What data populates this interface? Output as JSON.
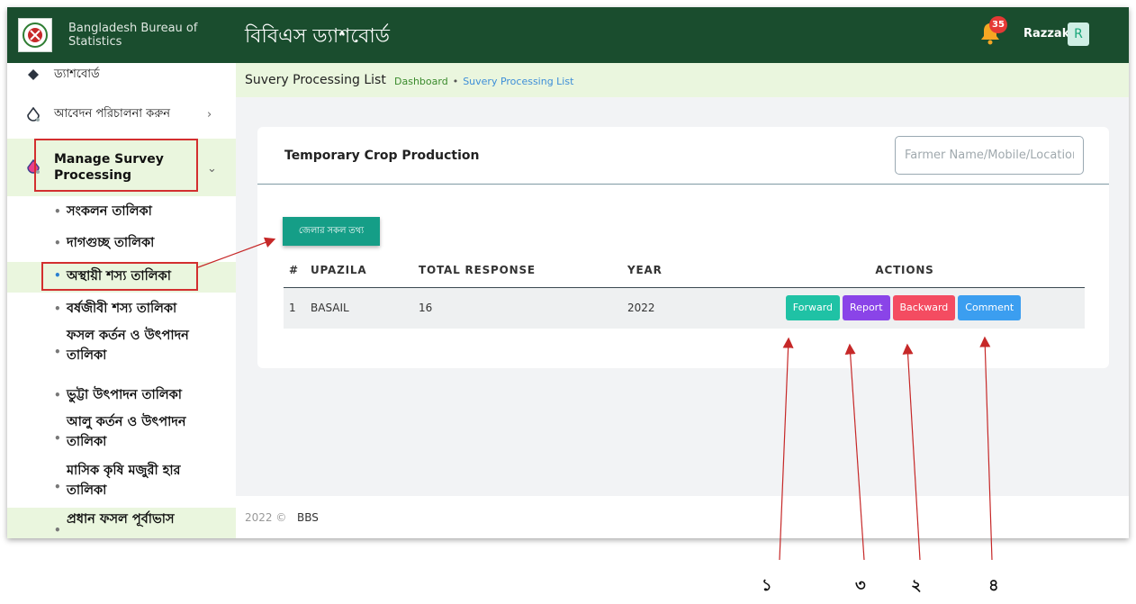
{
  "header": {
    "org_name": "Bangladesh Bureau of Statistics",
    "title": "বিবিএস ড্যাশবোর্ড",
    "notification_count": "35",
    "username": "Razzak",
    "avatar_initial": "R",
    "accent": "#1a4d2e"
  },
  "sidebar": {
    "items": [
      {
        "label": "ড্যাশবোর্ড",
        "icon": "diamond-icon"
      },
      {
        "label": "আবেদন পরিচালনা করুন",
        "icon": "drop-icon"
      },
      {
        "label": "Manage Survey Processing",
        "icon": "drop-icon"
      }
    ],
    "sub_items": [
      {
        "label": "সংকলন তালিকা"
      },
      {
        "label": "দাগগুচ্ছ তালিকা"
      },
      {
        "label": "অস্থায়ী শস্য তালিকা"
      },
      {
        "label": "বর্ষজীবী শস্য তালিকা"
      },
      {
        "label": "ফসল কর্তন ও উৎপাদন তালিকা"
      },
      {
        "label": "ভুট্টা উৎপাদন তালিকা"
      },
      {
        "label": "আলু কর্তন ও উৎপাদন তালিকা"
      },
      {
        "label": "মাসিক কৃষি মজুরী হার তালিকা"
      },
      {
        "label": "প্রধান ফসল পূর্বাভাস"
      }
    ]
  },
  "breadcrumb": {
    "title": "Suvery Processing List",
    "home": "Dashboard",
    "sep": "•",
    "current": "Suvery Processing List"
  },
  "card": {
    "title": "Temporary Crop Production",
    "search_placeholder": "Farmer Name/Mobile/Location",
    "district_button": "জেলার সকল তথ্য",
    "columns": [
      "#",
      "UPAZILA",
      "TOTAL RESPONSE",
      "YEAR",
      "ACTIONS"
    ],
    "rows": [
      {
        "num": "1",
        "upazila": "BASAIL",
        "total_response": "16",
        "year": "2022"
      }
    ],
    "actions": {
      "forward": "Forward",
      "report": "Report",
      "backward": "Backward",
      "comment": "Comment"
    }
  },
  "footer": {
    "year": "2022 ©",
    "org": "BBS"
  },
  "annotations": {
    "n1": "১",
    "n3": "৩",
    "n2": "২",
    "n4": "৪"
  }
}
